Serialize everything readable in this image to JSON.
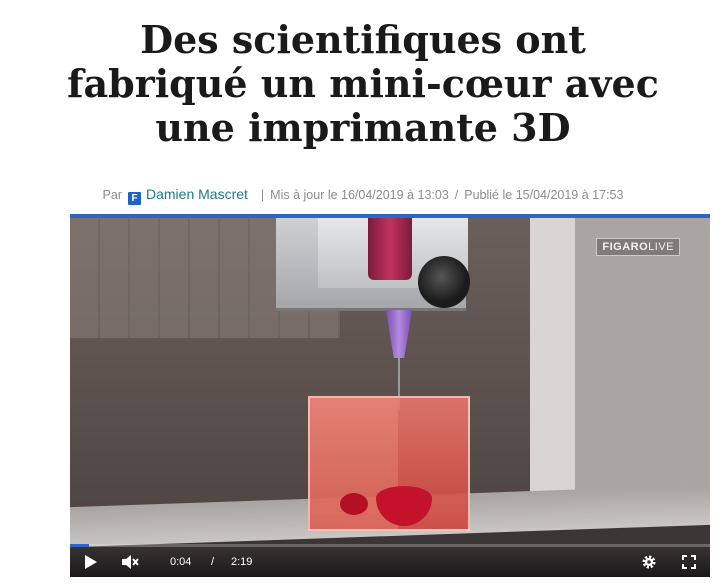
{
  "article": {
    "headline_line1": "Des scientifiques ont",
    "headline_line2": "fabriqué un mini-cœur avec",
    "headline_line3": "une imprimante 3D",
    "byline": {
      "by_label": "Par",
      "author_icon_letter": "F",
      "author": "Damien Mascret",
      "separator1": "|",
      "updated": "Mis à jour le 16/04/2019 à 13:03",
      "separator2": "/",
      "published": "Publié le 15/04/2019 à 17:53"
    }
  },
  "video": {
    "logo_brand": "FIGARO",
    "logo_live": "LIVE",
    "current_time": "0:04",
    "time_separator": "/",
    "duration": "2:19",
    "progress_fraction": 0.03,
    "icons": [
      "play-icon",
      "muted-speaker-icon",
      "gear-icon",
      "fullscreen-icon"
    ]
  },
  "colors": {
    "accent": "#2d66c6",
    "author_link": "#1c7a8c"
  }
}
